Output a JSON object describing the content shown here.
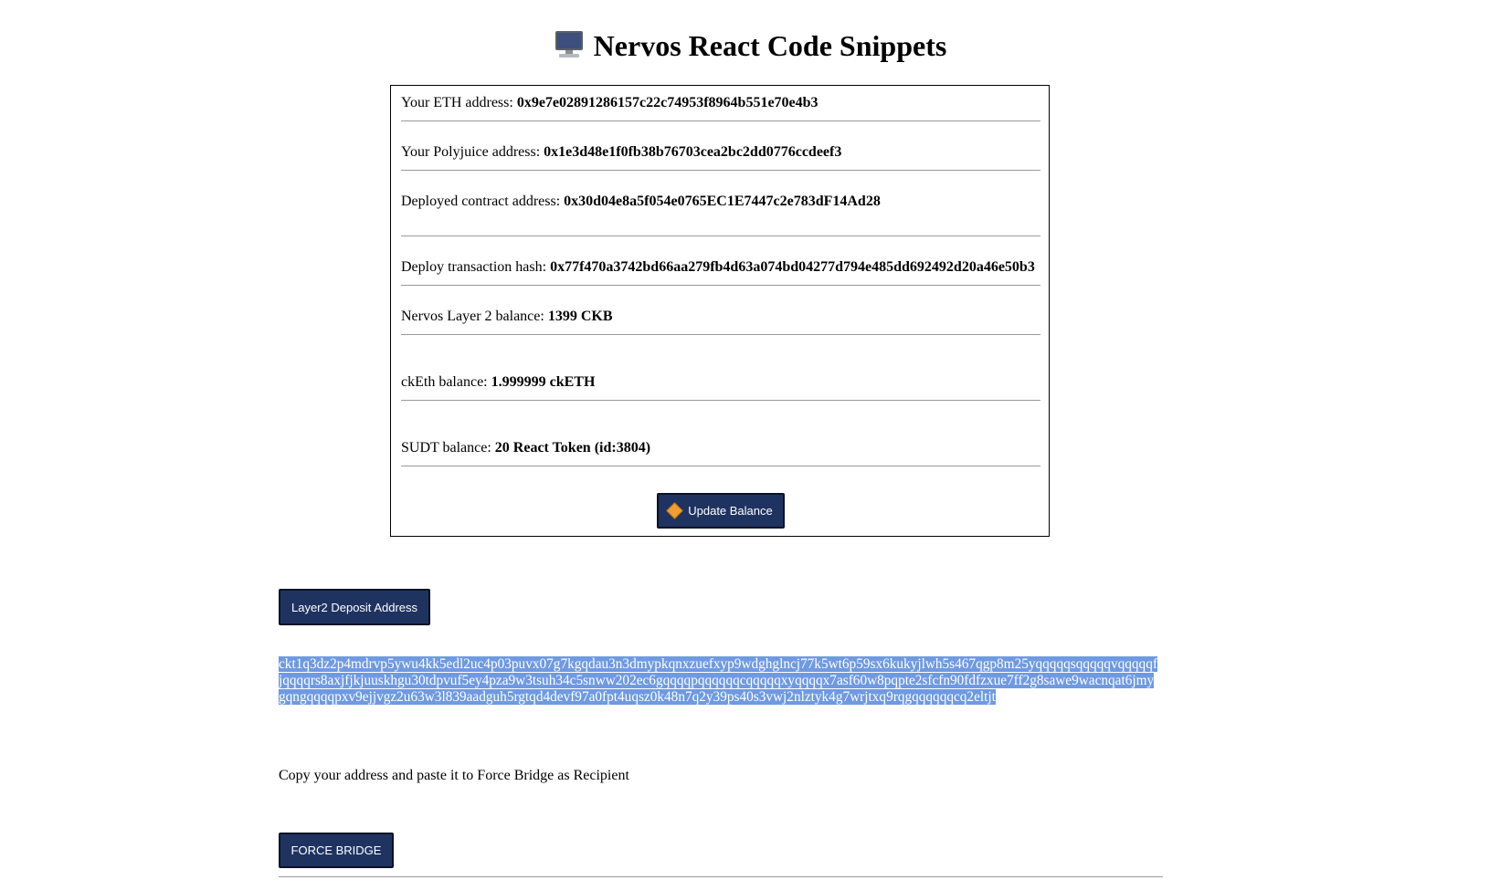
{
  "header": {
    "icon": "desktop-computer-icon",
    "title": "Nervos React Code Snippets"
  },
  "info": {
    "eth_label": "Your ETH address: ",
    "eth_value": "0x9e7e02891286157c22c74953f8964b551e70e4b3",
    "polyjuice_label": "Your Polyjuice address: ",
    "polyjuice_value": "0x1e3d48e1f0fb38b76703cea2bc2dd0776ccdeef3",
    "contract_label": "Deployed contract address: ",
    "contract_value": "0x30d04e8a5f054e0765EC1E7447c2e783dF14Ad28",
    "tx_label": "Deploy transaction hash: ",
    "tx_value": "0x77f470a3742bd66aa279fb4d63a074bd04277d794e485dd692492d20a46e50b3",
    "l2_label": "Nervos Layer 2 balance: ",
    "l2_value": "1399 CKB",
    "cketh_label": "ckEth balance: ",
    "cketh_value": "1.999999 ckETH",
    "sudt_label": "SUDT balance: ",
    "sudt_value": "20 React Token (id:3804)",
    "update_button": "Update Balance",
    "update_icon": "orange-diamond-icon"
  },
  "deposit": {
    "button": "Layer2 Deposit Address",
    "address": "ckt1q3dz2p4mdrvp5ywu4kk5edl2uc4p03puvx07g7kgqdau3n3dmypkqnxzuefxyp9wdghglncj77k5wt6p59sx6kukyjlwh5s467qgp8m25yqqqqqsqqqqqvqqqqqfjqqqqrs8axjfjkjuuskhgu30tdpvuf5ey4pza9w3tsuh34c5snww202ec6gqqqqpqqqqqqcqqqqqxyqqqqx7asf60w8pqpte2sfcfn90fdfzxue7ff2g8sawe9wacnqat6jmygqngqqqqpxv9ejjvgz2u63w3l839aadguh5rgtqd4devf97a0fpt4uqsz0k48n7q2y39ps40s3vwj2nlztyk4g7wrjtxq9rqgqqqqqqcq2eltjt",
    "highlight_color": "#6f9ae2",
    "instruction": "Copy your address and paste it to Force Bridge as Recipient",
    "force_button": "FORCE BRIDGE"
  },
  "colors": {
    "button_bg": "#1f3361",
    "divider": "#9a9a9a"
  }
}
